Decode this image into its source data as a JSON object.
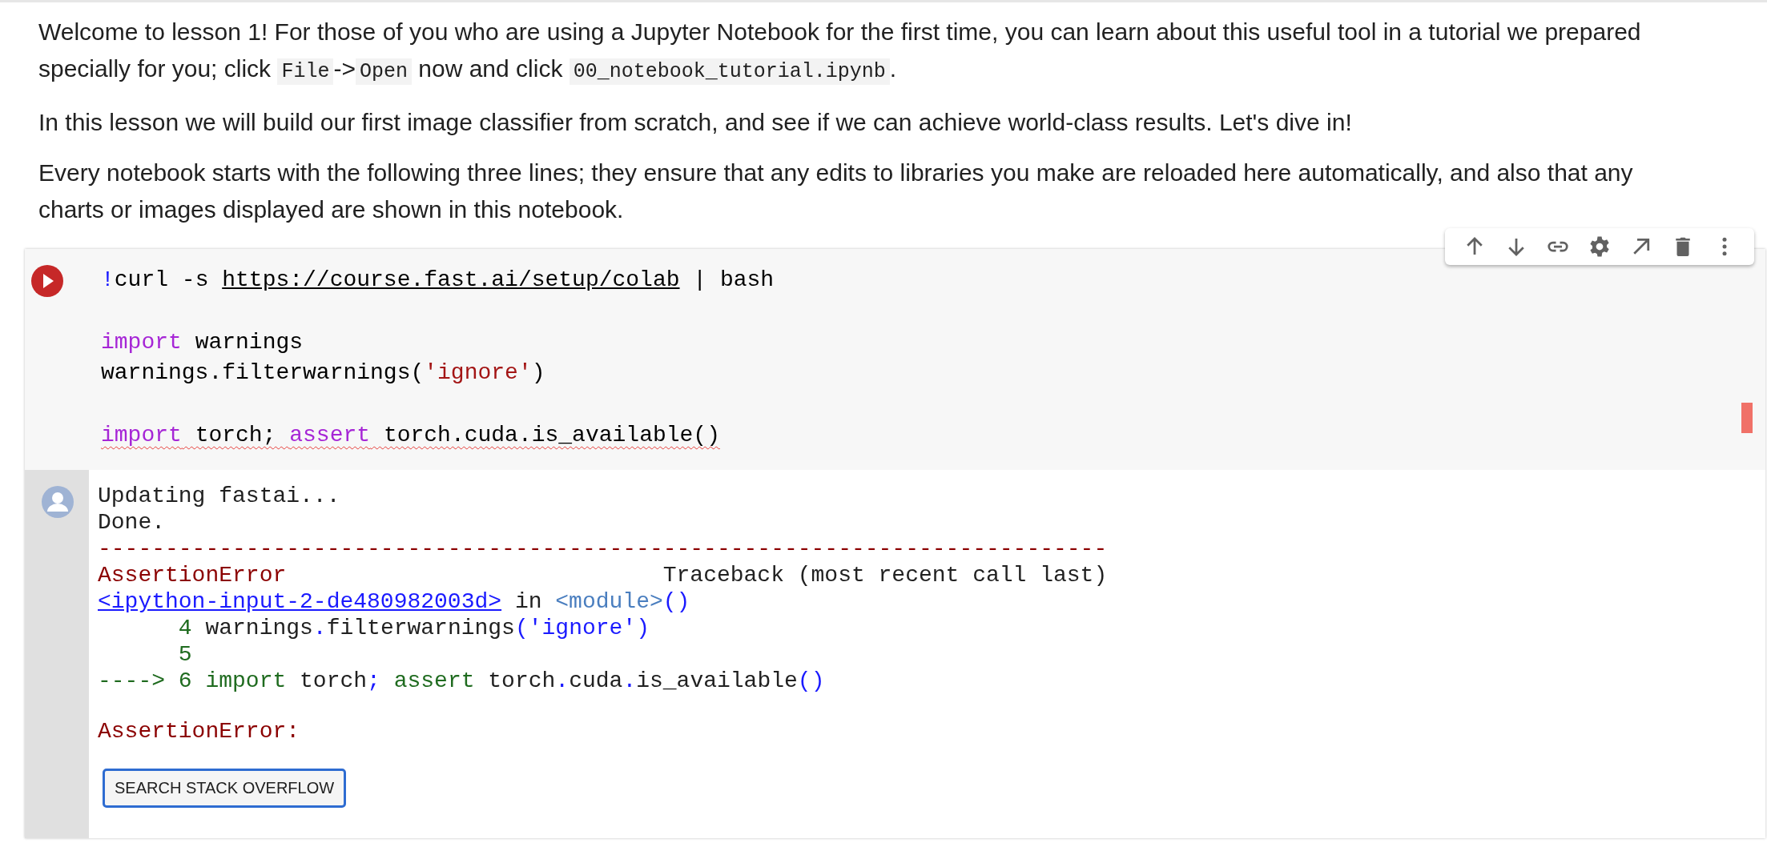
{
  "intro": [
    [
      {
        "text": "Welcome to lesson 1! For those of you who are using a Jupyter Notebook for the first time, you can learn about this useful tool in a tutorial we prepared specially for you; click ",
        "kind": "text"
      },
      {
        "text": "File",
        "kind": "code"
      },
      {
        "text": "->",
        "kind": "text"
      },
      {
        "text": "Open",
        "kind": "code"
      },
      {
        "text": " now and click ",
        "kind": "text"
      },
      {
        "text": "00_notebook_tutorial.ipynb",
        "kind": "code"
      },
      {
        "text": ".",
        "kind": "text"
      }
    ],
    [
      {
        "text": "In this lesson we will build our first image classifier from scratch, and see if we can achieve world-class results. Let's dive in!",
        "kind": "text"
      }
    ],
    [
      {
        "text": "Every notebook starts with the following three lines; they ensure that any edits to libraries you make are reloaded here automatically, and also that any charts or images displayed are shown in this notebook.",
        "kind": "text"
      }
    ]
  ],
  "cell": {
    "toolbar": [
      {
        "kind": "up"
      },
      {
        "kind": "down"
      },
      {
        "kind": "link"
      },
      {
        "kind": "settings"
      },
      {
        "kind": "open"
      },
      {
        "kind": "delete"
      },
      {
        "kind": "more"
      }
    ],
    "code": [
      [
        {
          "flagged": false,
          "tokens": [
            {
              "text": "!",
              "kind": "bang"
            },
            {
              "text": "curl -s ",
              "kind": "plain"
            },
            {
              "text": "https://course.fast.ai/setup/colab",
              "kind": "link"
            },
            {
              "text": " | bash",
              "kind": "plain"
            }
          ]
        }
      ],
      [
        {
          "flagged": false,
          "tokens": [
            {
              "text": "import",
              "kind": "keyword"
            },
            {
              "text": " warnings",
              "kind": "plain"
            }
          ]
        },
        {
          "flagged": false,
          "tokens": [
            {
              "text": "warnings.filterwarnings(",
              "kind": "plain"
            },
            {
              "text": "'ignore'",
              "kind": "string"
            },
            {
              "text": ")",
              "kind": "plain"
            }
          ]
        }
      ],
      [
        {
          "flagged": true,
          "tokens": [
            {
              "text": "import",
              "kind": "keyword"
            },
            {
              "text": " torch; ",
              "kind": "plain"
            },
            {
              "text": "assert",
              "kind": "keyword"
            },
            {
              "text": " torch.cuda.is_available()",
              "kind": "plain"
            }
          ]
        }
      ]
    ],
    "output": [
      [
        [
          {
            "text": "Updating fastai...",
            "kind": "plain"
          }
        ],
        [
          {
            "text": "Done.",
            "kind": "plain"
          }
        ],
        [
          {
            "text": "---------------------------------------------------------------------------",
            "kind": "red"
          }
        ],
        [
          {
            "text": "AssertionError",
            "kind": "red"
          },
          {
            "text": "                            Traceback (most recent call last)",
            "kind": "plain"
          }
        ],
        [
          {
            "text": "<ipython-input-2-de480982003d>",
            "kind": "link"
          },
          {
            "text": " in ",
            "kind": "plain"
          },
          {
            "text": "<module>",
            "kind": "module"
          },
          {
            "text": "()",
            "kind": "blue"
          }
        ],
        [
          {
            "text": "      4",
            "kind": "green"
          },
          {
            "text": " warnings",
            "kind": "plain"
          },
          {
            "text": ".",
            "kind": "blue"
          },
          {
            "text": "filterwarnings",
            "kind": "plain"
          },
          {
            "text": "('ignore')",
            "kind": "blue"
          }
        ],
        [
          {
            "text": "      5",
            "kind": "green"
          }
        ],
        [
          {
            "text": "----> 6 import",
            "kind": "green"
          },
          {
            "text": " torch",
            "kind": "plain"
          },
          {
            "text": ";",
            "kind": "blue"
          },
          {
            "text": " assert",
            "kind": "green"
          },
          {
            "text": " torch",
            "kind": "plain"
          },
          {
            "text": ".",
            "kind": "blue"
          },
          {
            "text": "cuda",
            "kind": "plain"
          },
          {
            "text": ".",
            "kind": "blue"
          },
          {
            "text": "is_available",
            "kind": "plain"
          },
          {
            "text": "()",
            "kind": "blue"
          }
        ]
      ],
      [
        [
          {
            "text": "AssertionError:",
            "kind": "red"
          }
        ]
      ]
    ],
    "button": "SEARCH STACK OVERFLOW"
  }
}
